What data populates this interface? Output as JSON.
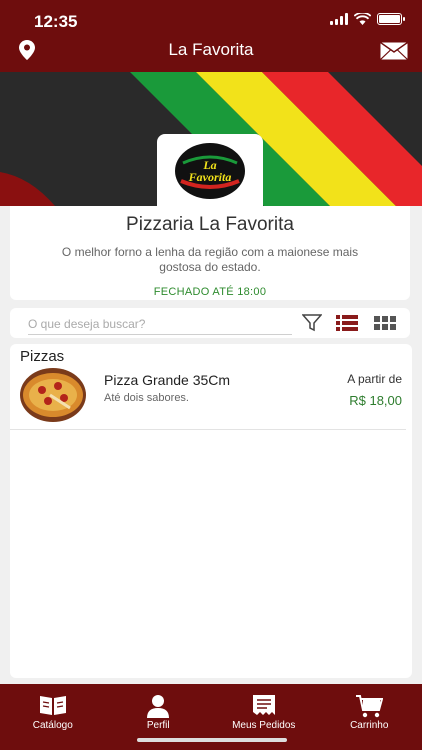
{
  "status_bar": {
    "time": "12:35"
  },
  "header": {
    "title": "La Favorita",
    "location_icon": "map-pin-icon",
    "contact_icon": "mail-icon"
  },
  "store": {
    "logo_text": "La Favorita",
    "name": "Pizzaria La Favorita",
    "description": "O melhor forno a lenha da região com a maionese mais gostosa do estado.",
    "status": "FECHADO ATÉ 18:00"
  },
  "search": {
    "placeholder": "O que deseja buscar?"
  },
  "catalog": {
    "category": "Pizzas",
    "items": [
      {
        "name": "Pizza Grande 35Cm",
        "description": "Até dois sabores.",
        "price_label": "A partir de",
        "price": "R$ 18,00"
      }
    ]
  },
  "tabbar": {
    "catalog": "Catálogo",
    "profile": "Perfil",
    "orders": "Meus Pedidos",
    "cart": "Carrinho"
  },
  "colors": {
    "brand": "#6e0d0d",
    "open_status": "#2e8b2e",
    "price": "#2e7d2e"
  }
}
